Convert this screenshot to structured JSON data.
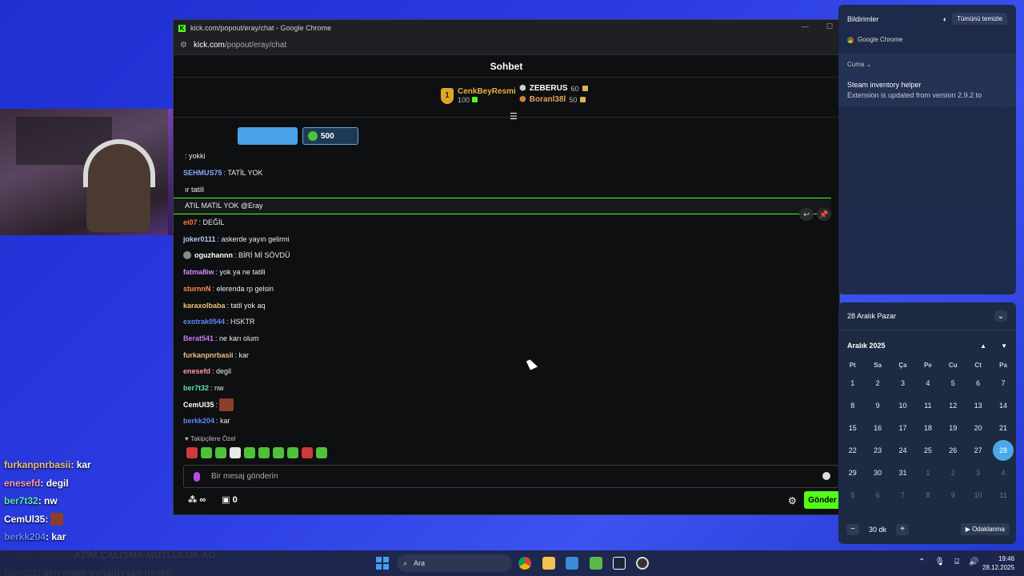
{
  "window": {
    "title": "kick.com/popout/eray/chat - Google Chrome",
    "url_domain": "kick.com",
    "url_path": "/popout/eray/chat"
  },
  "chat": {
    "header": "Sohbet",
    "leaders": {
      "top": {
        "rank": "1",
        "name": "CenkBeyResmi",
        "points": "100"
      },
      "others": [
        {
          "name": "ZEBERUS",
          "points": "60"
        },
        {
          "name": "Boranl38l",
          "points": "50"
        }
      ]
    },
    "pinned_amount": "500",
    "messages": [
      {
        "user": "",
        "text": ": yokki",
        "color": "#ffffff"
      },
      {
        "user": "SEHMUS75",
        "text": ": TATİL YOK",
        "color": "#8aa8ff"
      },
      {
        "user": "",
        "text": "ır tatili",
        "color": "#ffffff"
      },
      {
        "user": "",
        "text": "ATIL MATIL YOK @Eray",
        "color": "#ffffff"
      },
      {
        "user": "ei07",
        "text": ": DEĞİL",
        "color": "#ff7a3a"
      },
      {
        "user": "joker0111",
        "text": ": askerde yayın gelirmi",
        "color": "#b8c8ff"
      },
      {
        "user": "oguzhannn",
        "text": ": BİRİ Mİ SÖVDÜ",
        "color": "#ffffff"
      },
      {
        "user": "fatma8iw",
        "text": ": yok ya ne tatili",
        "color": "#d08aff"
      },
      {
        "user": "sturnnN",
        "text": ": elerenda rp gelsin",
        "color": "#ff8a4a"
      },
      {
        "user": "karaxolbaba",
        "text": ": tatil yok aq",
        "color": "#e8c27a"
      },
      {
        "user": "exotrak0544",
        "text": ": HSKTR",
        "color": "#5a8aff"
      },
      {
        "user": "Berat541",
        "text": ": ne karı olum",
        "color": "#c27aff"
      },
      {
        "user": "furkanpnrbasii",
        "text": ": kar",
        "color": "#e8c27a"
      },
      {
        "user": "enesefd",
        "text": ": degil",
        "color": "#ff9aa8"
      },
      {
        "user": "ber7t32",
        "text": ": nw",
        "color": "#5ae8a8"
      },
      {
        "user": "CemUl35",
        "text": ":",
        "color": "#ffffff"
      },
      {
        "user": "berkk204",
        "text": ": kar",
        "color": "#5a8aff"
      }
    ],
    "followers_label": "Takipçilere Özel",
    "input_placeholder": "Bir mesaj gönderin",
    "bottom_left_count": "∞",
    "bottom_gift_count": "0",
    "send_label": "Gönder"
  },
  "overlay": [
    {
      "user": "furkanpnrbasii",
      "text": " : kar",
      "color": "#e8c27a"
    },
    {
      "user": "enesefd",
      "text": " : degil",
      "color": "#ff9aa8"
    },
    {
      "user": "ber7t32",
      "text": " : nw",
      "color": "#5ae8a8"
    },
    {
      "user": "CemUl35",
      "text": " :",
      "color": "#ffffff"
    },
    {
      "user": "berkk204",
      "text": " : kar",
      "color": "#5a8aff"
    },
    {
      "user": "YoungShawze",
      "text": " : AZİM ÇALIŞMA MUTLULUK AG",
      "color": "#ff3a3a"
    },
    {
      "user": "Ege421",
      "text": " : sen gram oynadiysan neyim",
      "color": "#7ae85a"
    }
  ],
  "notifications": {
    "title": "Bildirimler",
    "clear_label": "Tümünü temizle",
    "app": "Google Chrome",
    "day": "Cuma",
    "card_title": "Steam inventory helper",
    "card_body": "Extension is updated from version 2.9.2 to"
  },
  "calendar": {
    "date_label": "28 Aralık Pazar",
    "month_label": "Aralık 2025",
    "weekdays": [
      "Pt",
      "Sa",
      "Ça",
      "Pe",
      "Cu",
      "Ct",
      "Pa"
    ],
    "days": [
      [
        "1",
        "2",
        "3",
        "4",
        "5",
        "6",
        "7"
      ],
      [
        "8",
        "9",
        "10",
        "11",
        "12",
        "13",
        "14"
      ],
      [
        "15",
        "16",
        "17",
        "18",
        "19",
        "20",
        "21"
      ],
      [
        "22",
        "23",
        "24",
        "25",
        "26",
        "27",
        "28"
      ],
      [
        "29",
        "30",
        "31",
        "1",
        "2",
        "3",
        "4"
      ],
      [
        "5",
        "6",
        "7",
        "8",
        "9",
        "10",
        "11"
      ]
    ],
    "today": "28",
    "focus_minutes": "30",
    "focus_unit": "dk",
    "focus_label": "Odaklanma"
  },
  "taskbar": {
    "search_placeholder": "Ara",
    "time": "19:46",
    "date": "28.12.2025"
  },
  "colors": {
    "kick_green": "#53fc18",
    "desktop_blue": "#2a3be0",
    "calendar_today": "#4aa8e8"
  }
}
